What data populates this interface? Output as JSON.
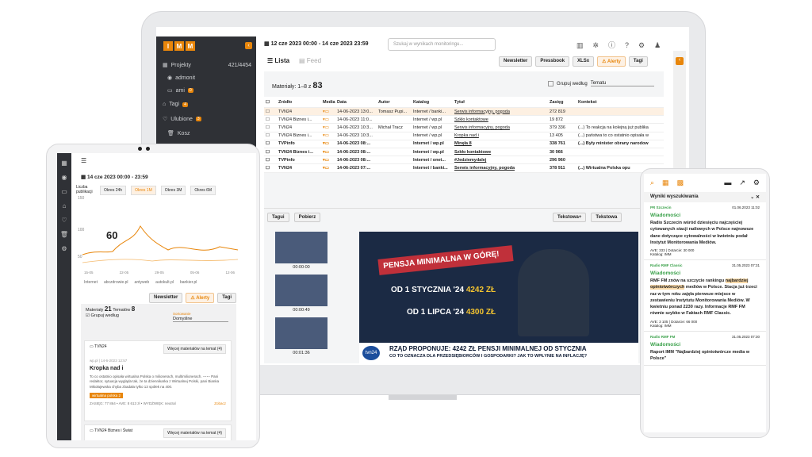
{
  "desktop": {
    "logo": [
      "I",
      "M",
      "M"
    ],
    "date_range": "12 cze 2023 00:00 - 14 cze 2023 23:59",
    "search_placeholder": "Szukaj w wynikach monitoringu...",
    "sidebar": [
      {
        "label": "Projekty",
        "count": "421/4454"
      },
      {
        "label": "admonit"
      },
      {
        "label": "ami",
        "badge": "0"
      },
      {
        "label": "Tagi",
        "badge": "4"
      },
      {
        "label": "Ulubione",
        "badge": "3"
      },
      {
        "label": "Kosz"
      }
    ],
    "view_tabs": {
      "list": "Lista",
      "feed": "Feed"
    },
    "toolbar": [
      "Newsletter",
      "Pressbook",
      "XLSx",
      "Alerty",
      "Tagi"
    ],
    "materials_label": "Materiały:",
    "materials_range": "1–8 z",
    "materials_total": "83",
    "group_label": "Grupuj według",
    "group_value": "Tematu",
    "columns": [
      "Źródło",
      "Media",
      "Data",
      "Autor",
      "Katalog",
      "Tytuł",
      "Zasięg",
      "Kontekst"
    ],
    "rows": [
      {
        "src": "TVN24",
        "date": "14-06-2023 13:0...",
        "author": "Tomasz Pupi...",
        "cat": "Internet / banki...",
        "title": "Serwis informacyjny, pogoda",
        "reach": "272 819",
        "ctx": ""
      },
      {
        "src": "TVN24 Biznes i...",
        "date": "14-06-2023 11:0...",
        "author": "",
        "cat": "Internet / wp.pl",
        "title": "Szkło kontaktowe",
        "reach": "19 872",
        "ctx": ""
      },
      {
        "src": "TVN24",
        "date": "14-06-2023 10:3...",
        "author": "Michał Tracz",
        "cat": "Internet / wp.pl",
        "title": "Serwis informacyjny, pogoda",
        "reach": "379 336",
        "ctx": "(...) To reakcja na kolejną już publika"
      },
      {
        "src": "TVN24 Biznes i...",
        "date": "14-06-2023 10:3...",
        "author": "",
        "cat": "Internet / wp.pl",
        "title": "Kropka nad i",
        "reach": "13 405",
        "ctx": "(...) państwa to co ostatnio opisała w"
      },
      {
        "src": "TVPinfo",
        "date": "14-06-2023 08:...",
        "author": "",
        "cat": "Internet / wp.pl",
        "title": "Minęła 8",
        "reach": "338 761",
        "ctx": "(...) Były minister obrany narodow"
      },
      {
        "src": "TVN24 Biznes i...",
        "date": "14-06-2023 08:...",
        "author": "",
        "cat": "Internet / wp.pl",
        "title": "Szkło kontaktowe",
        "reach": "30 966",
        "ctx": ""
      },
      {
        "src": "TVPinfo",
        "date": "14-06-2023 08:...",
        "author": "",
        "cat": "Internet / onet...",
        "title": "#Jedziemydalej",
        "reach": "296 960",
        "ctx": ""
      },
      {
        "src": "TVN24",
        "date": "14-06-2023 07:...",
        "author": "",
        "cat": "Internet / banki...",
        "title": "Serwis informacyjny, pogoda",
        "reach": "378 911",
        "ctx": "(...) Wirtualna Polska opu"
      }
    ],
    "bottom_tabs": [
      "Tagui",
      "Pobierz",
      "Tekstowa+",
      "Tekstowa"
    ],
    "thumb_times": [
      "00:00:00",
      "00:00:49",
      "00:01:36"
    ],
    "video": {
      "banner1": "PENSJA MINIMALNA W GÓRĘ!",
      "line1": "OD 1 STYCZNIA '24",
      "val1": "4242 ZŁ",
      "line2": "OD 1 LIPCA '24",
      "val2": "4300 ZŁ",
      "headline": "RZĄD PROPONUJE: 4242 ZŁ PENSJI MINIMALNEJ OD STYCZNIA",
      "subhead": "CO TO OZNACZA DLA PRZEDSIĘBIORCÓW I GOSPODARKI? JAK TO WPŁYNIE NA INFLACJĘ?",
      "logo": "tvn24"
    }
  },
  "tablet": {
    "date_range": "14 cze 2023 00:00 - 23:59",
    "period_label": "Liczba publikacji",
    "periods": [
      "Okres 24h",
      "Okres 1M",
      "Okres 3M",
      "Okres 6M"
    ],
    "y_ticks": [
      "150",
      "100",
      "50"
    ],
    "peak_value": "60",
    "x_ticks": [
      "15-05",
      "22-05",
      "29-05",
      "05-06",
      "12-06"
    ],
    "legend": [
      "Internet",
      "abczdrowie.pl",
      "antyweb",
      "autokult.pl",
      "bankier.pl"
    ],
    "buttons": [
      "Newsletter",
      "Alerty",
      "Tagi"
    ],
    "materials_label": "Materiały",
    "materials_count": "21",
    "topics_label": "Tematów",
    "topics_count": "8",
    "group_label": "Grupuj według",
    "sort_label": "Sortowanie",
    "sort_value": "Domyślne",
    "card1": {
      "source": "TVN24",
      "more": "Więcej materiałów na temat (4)",
      "meta": "wp.pl   |   14-6-2023 12:57",
      "title": "Kropka nad i",
      "snippet": "To co ostatnio opisała wirtualna Polska o milionerach, multimilionerach. ⁃⁃⁃⁃ Pani redaktor, sytuacja wygląda tak, że ta dziennikarka z Wirtualnej Polski, pani Bianka Mikołajewska chyba zbadała tylko 13 spółek na 400.",
      "tag": "wirtualna polska 2",
      "stats": "ZASIĘG: 77 864 • AVE: 8 613 zł • WYDŹWIĘK: neutral",
      "expand": "Zobacz"
    },
    "card2": {
      "source": "TVN24 Biznes i Świat",
      "more": "Więcej materiałów na temat (4)"
    }
  },
  "phone": {
    "header": "Wyniki wyszukiwania",
    "items": [
      {
        "source": "PR Szczecin",
        "date": "01.06.2023 11:02",
        "kind": "Wiadomości",
        "text": "Radio Szczecin wśród dziesięciu najczęściej cytowanych stacji radiowych w Polsce najnowsze dane dotyczące cytowalności w kwietniu podał Instytut Monitorowania Mediów.",
        "stats": "AVE: 333 | Dotarcie: 30 000",
        "cat": "Katalog: IMM"
      },
      {
        "source": "Radio RMF Classic",
        "date": "31.05.2023 07:31",
        "kind": "Wiadomości",
        "text_a": "RMF FM znów na szczycie rankingu ",
        "text_hl": "najbardziej opiniotwórczych",
        "text_b": " mediów w Polsce. Stacja już trzeci raz w tym roku zajęła pierwsze miejsce w zestawieniu Instytutu Monitorowania Mediów. W kwietniu ponad 2230 razy. Informacje RMF FM równie szybko w Faktach RMF Classic.",
        "stats": "AVE: 3 105 | Dotarcie: 66 000",
        "cat": "Katalog: IMM"
      },
      {
        "source": "Radio RMF FM",
        "date": "31.05.2023 07:30",
        "kind": "Wiadomości",
        "text": "Raport IMM \"Najbardziej opiniotwórcze media w Polsce\""
      }
    ]
  },
  "colors": {
    "accent": "#e8860b",
    "sidebar": "#2f3136",
    "green": "#3aa14a"
  }
}
